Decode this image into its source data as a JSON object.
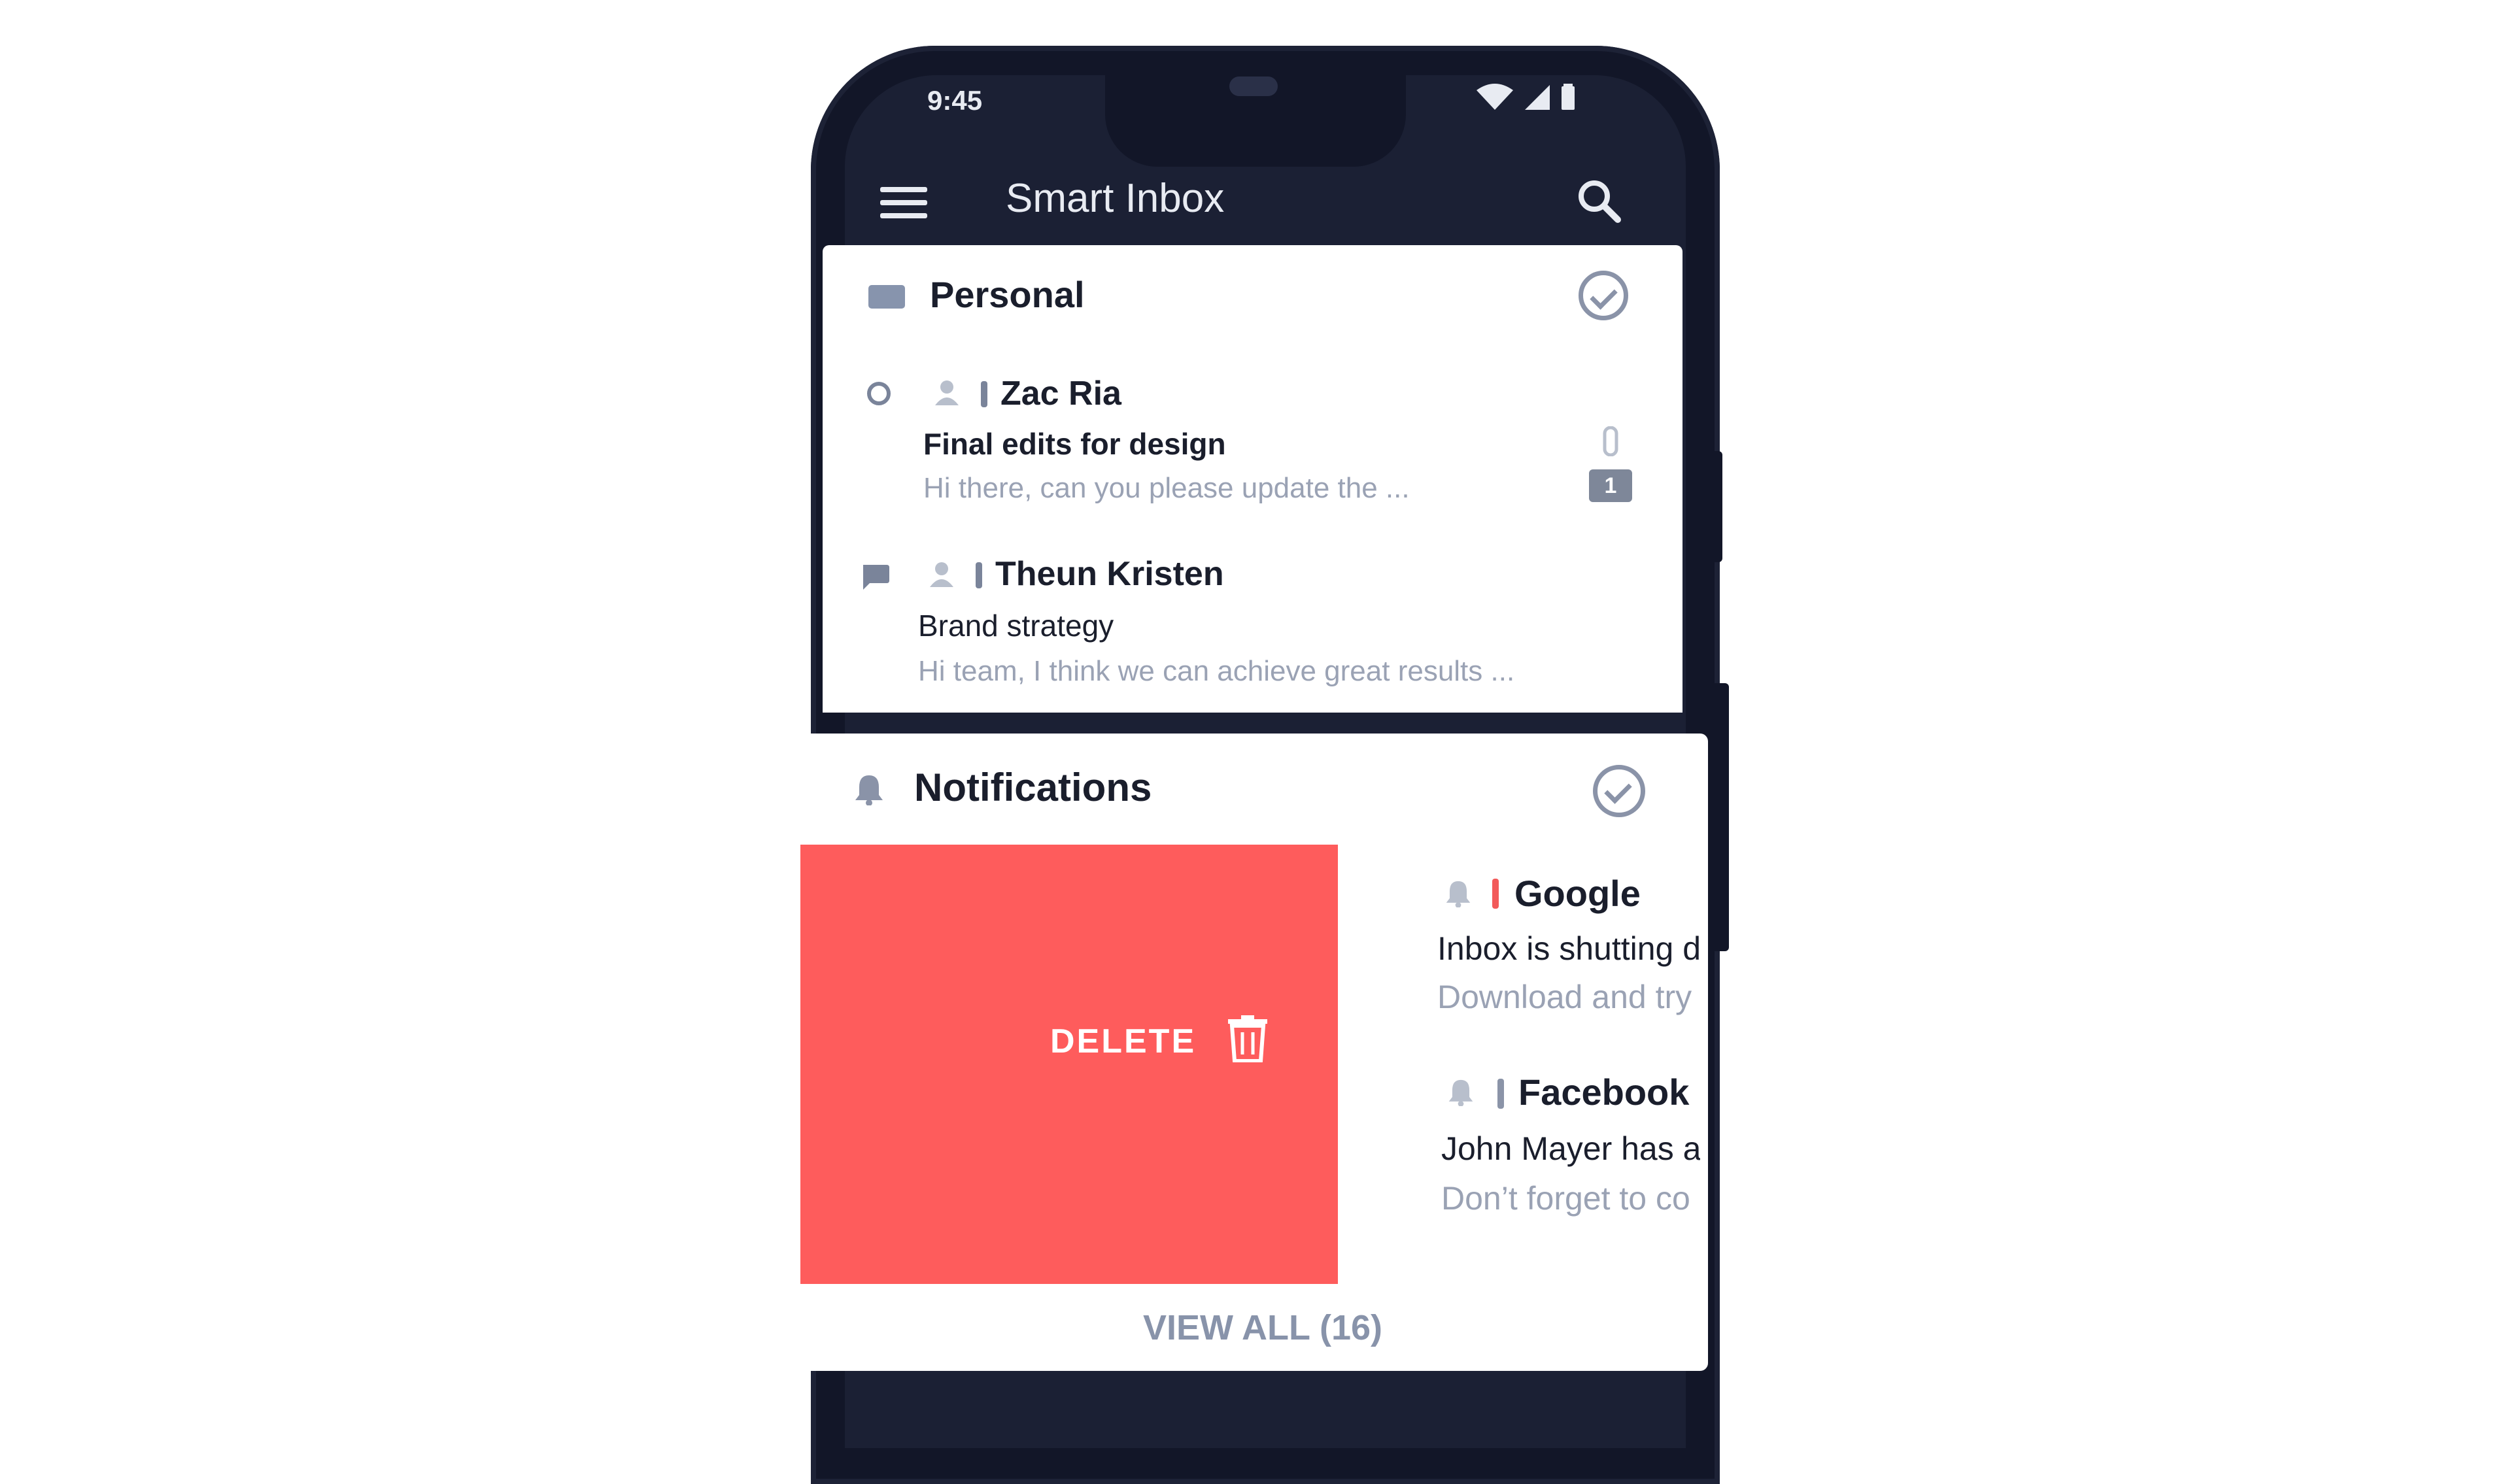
{
  "status_bar": {
    "time": "9:45"
  },
  "app_bar": {
    "title": "Smart Inbox"
  },
  "sections": {
    "personal": {
      "title": "Personal",
      "emails": [
        {
          "sender": "Zac Ria",
          "subject": "Final edits for design",
          "preview": "Hi there, can you please update the ...",
          "badge": "1"
        },
        {
          "sender": "Theun Kristen",
          "subject": "Brand strategy",
          "preview": "Hi team, I think we can achieve great results ..."
        }
      ]
    },
    "notifications": {
      "title": "Notifications",
      "items": [
        {
          "sender": "Google",
          "subject": "Inbox is shutting d",
          "preview": "Download and try",
          "bar_color": "#f25a5a"
        },
        {
          "sender": "Facebook",
          "subject": "John Mayer has a",
          "preview": "Don’t forget to co",
          "bar_color": "#8b94a8"
        }
      ],
      "swipe_action": "DELETE",
      "view_all": "VIEW ALL (16)"
    }
  },
  "colors": {
    "delete": "#fe5c5c",
    "frame": "#121628",
    "appbar": "#1b2034"
  }
}
